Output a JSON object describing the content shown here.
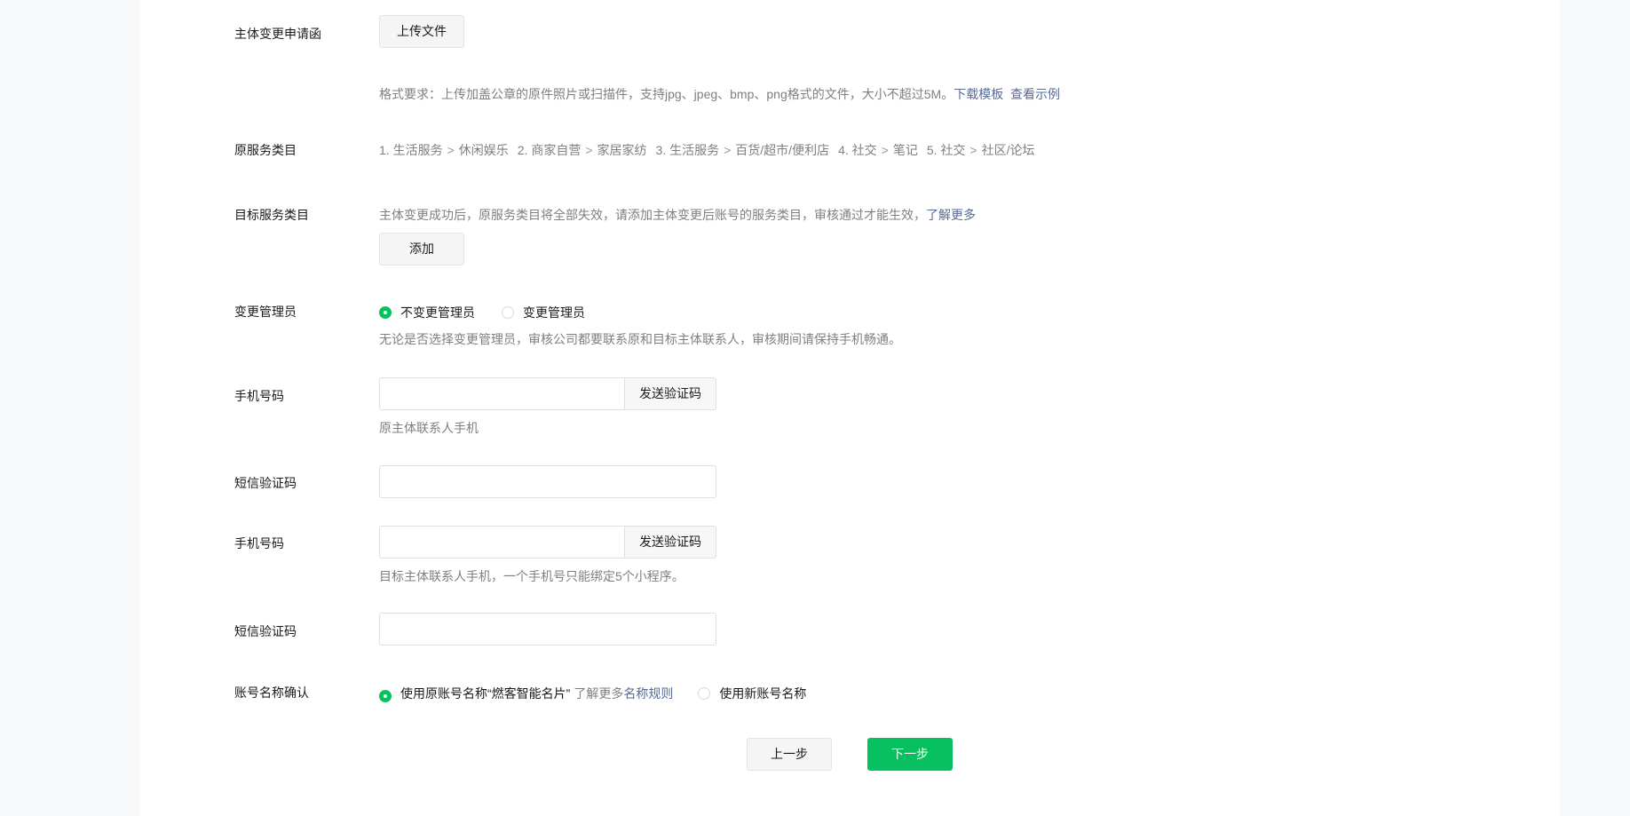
{
  "upload": {
    "label": "主体变更申请函",
    "button": "上传文件",
    "hint": "格式要求：上传加盖公章的原件照片或扫描件，支持jpg、jpeg、bmp、png格式的文件，大小不超过5M。",
    "download_template": "下载模板",
    "view_example": "查看示例"
  },
  "original_categories": {
    "label": "原服务类目",
    "items": [
      {
        "index": "1.",
        "path": [
          "生活服务",
          "休闲娱乐"
        ]
      },
      {
        "index": "2.",
        "path": [
          "商家自营",
          "家居家纺"
        ]
      },
      {
        "index": "3.",
        "path": [
          "生活服务",
          "百货/超市/便利店"
        ]
      },
      {
        "index": "4.",
        "path": [
          "社交",
          "笔记"
        ]
      },
      {
        "index": "5.",
        "path": [
          "社交",
          "社区/论坛"
        ]
      }
    ]
  },
  "target_categories": {
    "label": "目标服务类目",
    "hint": "主体变更成功后，原服务类目将全部失效，请添加主体变更后账号的服务类目，审核通过才能生效，",
    "learn_more": "了解更多",
    "add_button": "添加"
  },
  "change_admin": {
    "label": "变更管理员",
    "options": [
      "不变更管理员",
      "变更管理员"
    ],
    "selected": 0,
    "hint": "无论是否选择变更管理员，审核公司都要联系原和目标主体联系人，审核期间请保持手机畅通。"
  },
  "phone_original": {
    "label": "手机号码",
    "value": "",
    "send_code": "发送验证码",
    "hint": "原主体联系人手机"
  },
  "sms_original": {
    "label": "短信验证码",
    "value": ""
  },
  "phone_target": {
    "label": "手机号码",
    "value": "",
    "send_code": "发送验证码",
    "hint": "目标主体联系人手机，一个手机号只能绑定5个小程序。"
  },
  "sms_target": {
    "label": "短信验证码",
    "value": ""
  },
  "account_name": {
    "label": "账号名称确认",
    "option_original": "使用原账号名称“燃客智能名片”",
    "learn_more_prefix": "了解更多",
    "name_rules": "名称规则",
    "option_new": "使用新账号名称",
    "selected": 0
  },
  "footer": {
    "prev": "上一步",
    "next": "下一步"
  },
  "colors": {
    "accent": "#07c160",
    "link": "#576b95",
    "hint": "#7f7f7f"
  }
}
